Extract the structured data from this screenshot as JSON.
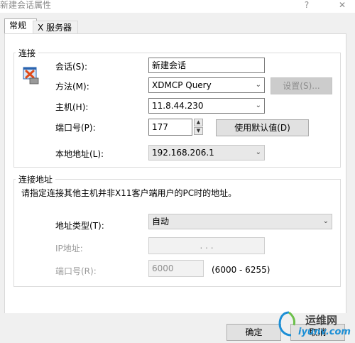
{
  "window": {
    "title": "新建会话属性",
    "help_glyph": "?",
    "close_glyph": "✕"
  },
  "tabs": [
    {
      "label": "常规"
    },
    {
      "label": "X 服务器"
    }
  ],
  "connect_group": {
    "title": "连接",
    "session_label": "会话(S):",
    "session_value": "新建会话",
    "method_label": "方法(M):",
    "method_value": "XDMCP Query",
    "settings_button": "设置(S)...",
    "host_label": "主机(H):",
    "host_value": "11.8.44.230",
    "port_label": "端口号(P):",
    "port_value": "177",
    "default_button": "使用默认值(D)",
    "local_addr_label": "本地地址(L):",
    "local_addr_value": "192.168.206.1"
  },
  "address_group": {
    "title": "连接地址",
    "description": "请指定连接其他主机并非X11客户端用户的PC时的地址。",
    "type_label": "地址类型(T):",
    "type_value": "自动",
    "ip_label": "IP地址:",
    "ip_dots": ".     .     .",
    "port_label": "端口号(R):",
    "port_value": "6000",
    "port_range": "(6000 - 6255)"
  },
  "footer": {
    "ok_button": "确定",
    "cancel_button": "取消",
    "watermark": "运维网",
    "watermark_domain": "iyunv.com"
  },
  "icons": {
    "chevron": "⌄",
    "spin_up": "▲",
    "spin_down": "▼"
  }
}
